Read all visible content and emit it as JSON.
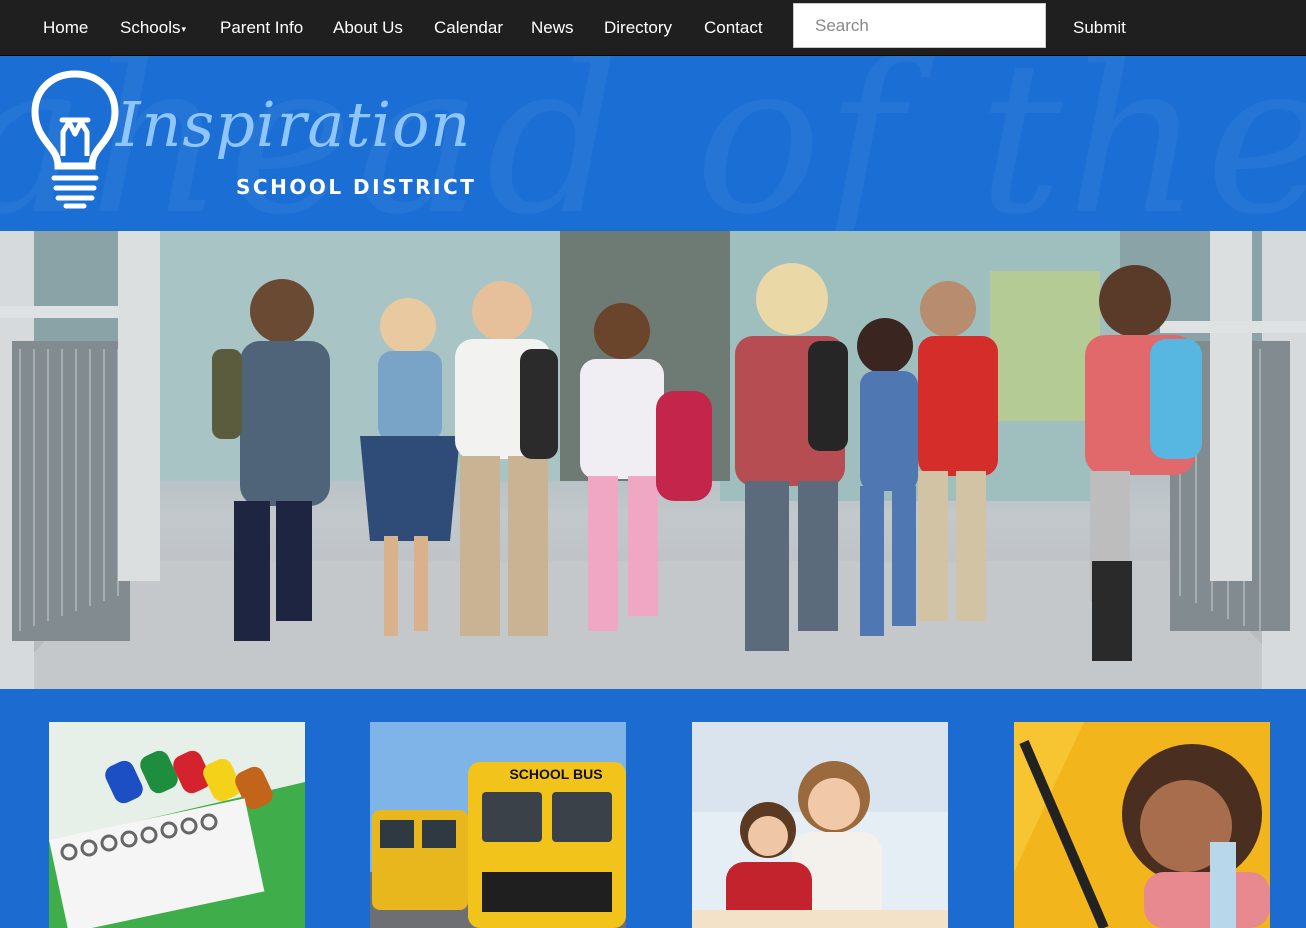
{
  "nav": {
    "items": [
      {
        "label": "Home"
      },
      {
        "label": "Schools",
        "has_dropdown": true
      },
      {
        "label": "Parent Info"
      },
      {
        "label": "About Us"
      },
      {
        "label": "Calendar"
      },
      {
        "label": "News"
      },
      {
        "label": "Directory"
      },
      {
        "label": "Contact"
      }
    ],
    "search_placeholder": "Search",
    "search_value": "",
    "submit_label": "Submit"
  },
  "header": {
    "logo_word": "Inspiration",
    "logo_subtitle": "SCHOOL DISTRICT"
  },
  "colors": {
    "nav_bg": "#1f1f1f",
    "brand_blue": "#1b6fd4",
    "logo_light_blue": "#8fc6ff"
  },
  "icons": [
    "caret-down-icon",
    "lightbulb-icon"
  ]
}
